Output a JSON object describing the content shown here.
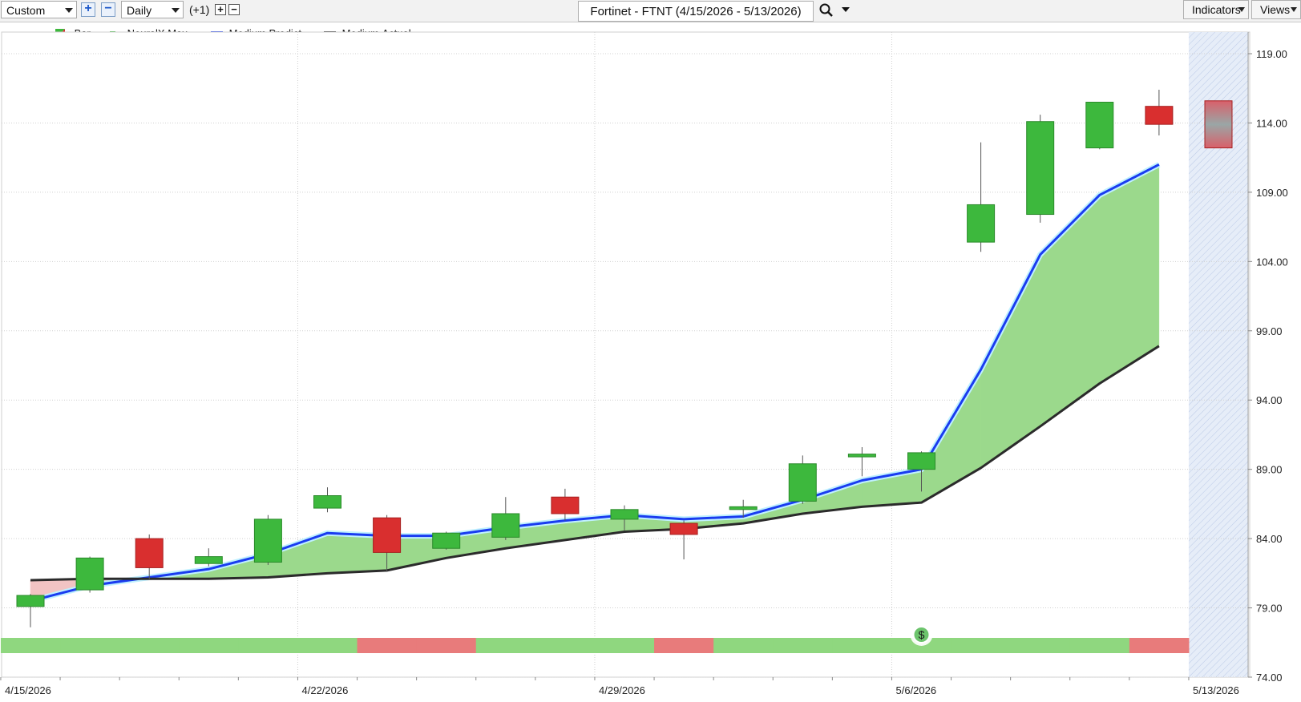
{
  "toolbar": {
    "template_select": "Custom",
    "period_select": "Daily",
    "offset_label": "(+1)",
    "chart_title": "Fortinet - FTNT (4/15/2026 - 5/13/2026)",
    "indicators_label": "Indicators",
    "views_label": "Views"
  },
  "legend": {
    "bar": "Bar",
    "neural": "NeuralX.Max",
    "predict": "Medium.Predict",
    "actual": "Medium.Actual"
  },
  "signal_marker": "$",
  "colors": {
    "up_candle": "#3db83d",
    "down_candle": "#d92f2f",
    "predict_line": "#1a3cf0",
    "actual_line": "#2b2b2b",
    "fill_above": "#9bd98c",
    "fill_below": "#f2c4c4",
    "band_green": "#8fd77f",
    "band_red": "#e87b7b"
  },
  "chart_data": {
    "type": "candlestick",
    "y_ticks": [
      "119.00",
      "114.00",
      "109.00",
      "104.00",
      "99.00",
      "94.00",
      "89.00",
      "84.00",
      "79.00",
      "74.00"
    ],
    "ylim": [
      74,
      119
    ],
    "x_ticks": [
      {
        "index": 0,
        "label": "4/15/2026"
      },
      {
        "index": 5,
        "label": "4/22/2026"
      },
      {
        "index": 10,
        "label": "4/29/2026"
      },
      {
        "index": 15,
        "label": "5/6/2026"
      },
      {
        "index": 20,
        "label": "5/13/2026"
      }
    ],
    "candles": [
      {
        "o": 79.1,
        "h": 80.0,
        "l": 77.6,
        "c": 79.9
      },
      {
        "o": 80.3,
        "h": 82.7,
        "l": 80.1,
        "c": 82.6
      },
      {
        "o": 84.0,
        "h": 84.3,
        "l": 81.0,
        "c": 81.9
      },
      {
        "o": 82.2,
        "h": 83.3,
        "l": 82.0,
        "c": 82.7
      },
      {
        "o": 82.3,
        "h": 85.7,
        "l": 82.1,
        "c": 85.4
      },
      {
        "o": 86.2,
        "h": 87.7,
        "l": 85.9,
        "c": 87.1
      },
      {
        "o": 85.5,
        "h": 85.7,
        "l": 81.6,
        "c": 83.0
      },
      {
        "o": 83.3,
        "h": 84.5,
        "l": 83.2,
        "c": 84.4
      },
      {
        "o": 84.1,
        "h": 87.0,
        "l": 83.9,
        "c": 85.8
      },
      {
        "o": 87.0,
        "h": 87.6,
        "l": 85.3,
        "c": 85.8
      },
      {
        "o": 85.4,
        "h": 86.4,
        "l": 84.6,
        "c": 86.1
      },
      {
        "o": 85.1,
        "h": 85.3,
        "l": 82.5,
        "c": 84.3
      },
      {
        "o": 86.1,
        "h": 86.8,
        "l": 85.5,
        "c": 86.3
      },
      {
        "o": 86.7,
        "h": 90.0,
        "l": 86.5,
        "c": 89.4
      },
      {
        "o": 89.9,
        "h": 90.6,
        "l": 88.5,
        "c": 90.1
      },
      {
        "o": 89.0,
        "h": 90.3,
        "l": 87.4,
        "c": 90.2
      },
      {
        "o": 105.4,
        "h": 112.6,
        "l": 104.7,
        "c": 108.1
      },
      {
        "o": 107.4,
        "h": 114.6,
        "l": 106.8,
        "c": 114.1
      },
      {
        "o": 112.2,
        "h": 115.5,
        "l": 112.1,
        "c": 115.5
      },
      {
        "o": 115.2,
        "h": 116.4,
        "l": 113.1,
        "c": 113.9
      },
      {
        "o": 115.6,
        "h": 115.6,
        "l": 112.2,
        "c": 112.2,
        "projected": true
      }
    ],
    "series": [
      {
        "name": "Medium.Predict",
        "values": [
          79.5,
          80.6,
          81.2,
          81.8,
          82.9,
          84.4,
          84.2,
          84.2,
          84.8,
          85.3,
          85.7,
          85.4,
          85.6,
          86.8,
          88.2,
          89.0,
          96.2,
          104.5,
          108.8,
          111.0
        ]
      },
      {
        "name": "Medium.Actual",
        "values": [
          81.0,
          81.1,
          81.1,
          81.1,
          81.2,
          81.5,
          81.7,
          82.6,
          83.3,
          83.9,
          84.5,
          84.7,
          85.1,
          85.8,
          86.3,
          86.6,
          89.1,
          92.1,
          95.2,
          97.9
        ]
      }
    ],
    "signal_band": [
      "green",
      "green",
      "green",
      "green",
      "green",
      "green",
      "red",
      "red",
      "green",
      "green",
      "green",
      "red",
      "green",
      "green",
      "green",
      "green",
      "green",
      "green",
      "green",
      "red"
    ],
    "signal_index": 15
  }
}
